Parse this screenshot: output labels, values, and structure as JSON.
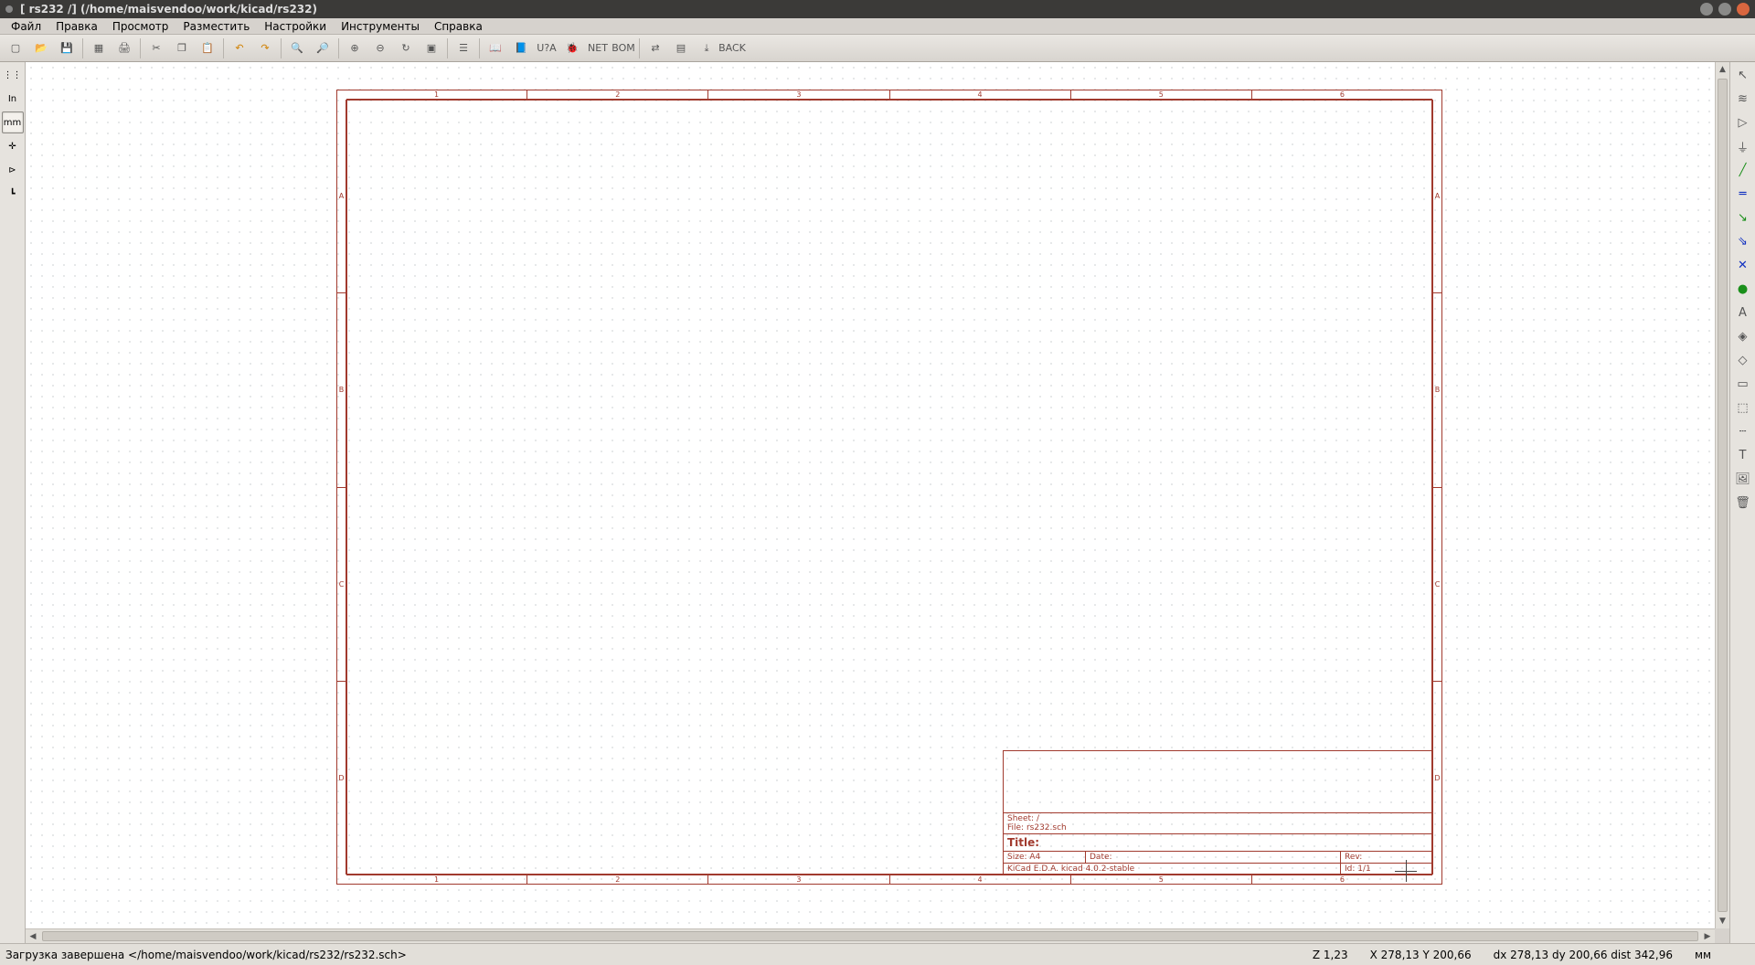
{
  "window": {
    "title": "[ rs232 /] (/home/maisvendoo/work/kicad/rs232)",
    "btn_min": "#8a8a88",
    "btn_max": "#8a8a88",
    "btn_close": "#d9663f"
  },
  "menu": {
    "items": [
      "Файл",
      "Правка",
      "Просмотр",
      "Разместить",
      "Настройки",
      "Инструменты",
      "Справка"
    ]
  },
  "toolbar_top": [
    "new-icon",
    "open-icon",
    "save-icon",
    "|",
    "page-setup-icon",
    "print-icon",
    "|",
    "cut-icon",
    "copy-icon",
    "paste-icon",
    "|",
    "undo-icon",
    "redo-icon",
    "|",
    "find-icon",
    "find-replace-icon",
    "|",
    "zoom-in-icon",
    "zoom-out-icon",
    "zoom-redraw-icon",
    "zoom-fit-icon",
    "|",
    "hierarchy-icon",
    "|",
    "library-browser-icon",
    "library-editor-icon",
    "annotate-icon",
    "erc-icon",
    "netlist-icon",
    "bom-icon",
    "|",
    "cvpcb-icon",
    "pcbnew-icon",
    "import-icon",
    "back-icon"
  ],
  "left_toolbar": [
    {
      "name": "grid-toggle-icon",
      "label": "",
      "active": false
    },
    {
      "name": "units-inches-icon",
      "label": "In",
      "active": false
    },
    {
      "name": "units-mm-icon",
      "label": "mm",
      "active": true
    },
    {
      "name": "cursor-shape-icon",
      "label": "",
      "active": false
    },
    {
      "name": "hidden-pins-icon",
      "label": "",
      "active": false
    },
    {
      "name": "bus-direction-icon",
      "label": "",
      "active": false
    }
  ],
  "right_toolbar": [
    "select-icon",
    "highlight-net-icon",
    "place-component-icon",
    "place-power-icon",
    "place-wire-icon",
    "place-bus-icon",
    "place-wire2bus-icon",
    "place-bus2bus-icon",
    "place-noconnect-icon",
    "place-junction-icon",
    "place-net-label-icon",
    "place-global-label-icon",
    "place-hier-label-icon",
    "place-hier-sheet-icon",
    "import-hier-label-icon",
    "place-dashed-line-icon",
    "place-text-icon",
    "place-image-icon",
    "delete-icon"
  ],
  "ruler": {
    "top": [
      "1",
      "2",
      "3",
      "4",
      "5",
      "6"
    ],
    "left": [
      "A",
      "B",
      "C",
      "D"
    ]
  },
  "titleblock": {
    "sheet_label": "Sheet:",
    "sheet_value": "/",
    "file_label": "File:",
    "file_value": "rs232.sch",
    "title_label": "Title:",
    "size_label": "Size:",
    "size_value": "A4",
    "date_label": "Date:",
    "rev_label": "Rev:",
    "generator": "KiCad E.D.A.  kicad 4.0.2-stable",
    "id_label": "Id:",
    "id_value": "1/1"
  },
  "status": {
    "message": "Загрузка завершена </home/maisvendoo/work/kicad/rs232/rs232.sch>",
    "zoom": "Z 1,23",
    "coords": "X 278,13  Y 200,66",
    "delta": "dx 278,13  dy 200,66  dist 342,96",
    "units": "мм"
  }
}
